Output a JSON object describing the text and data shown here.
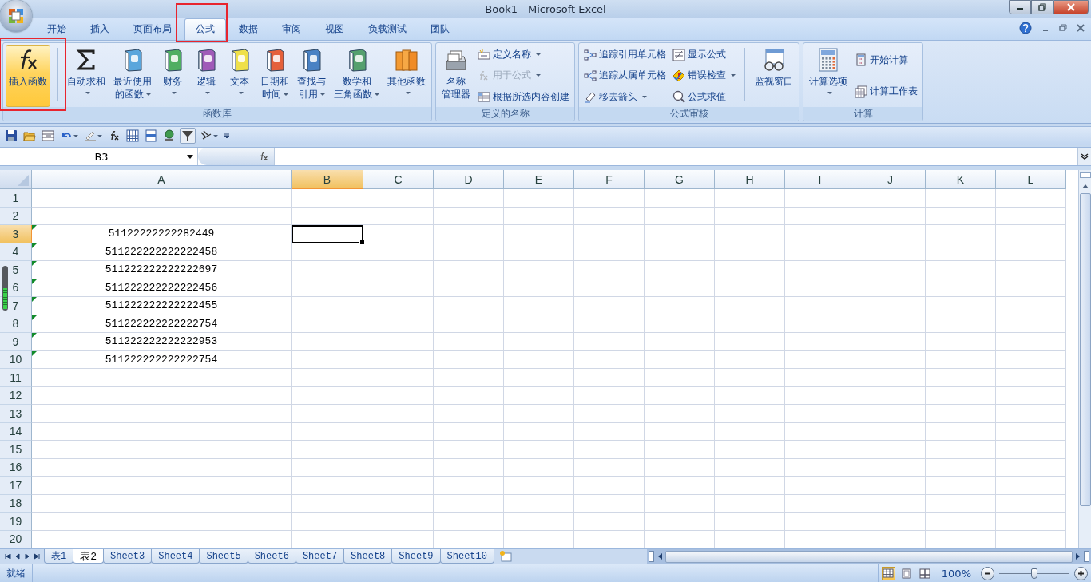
{
  "window": {
    "title": "Book1 - Microsoft Excel"
  },
  "ribbon_tabs": [
    {
      "label": "开始",
      "selected": false,
      "highlighted": false
    },
    {
      "label": "插入",
      "selected": false,
      "highlighted": false
    },
    {
      "label": "页面布局",
      "selected": false,
      "highlighted": false
    },
    {
      "label": "公式",
      "selected": true,
      "highlighted": true
    },
    {
      "label": "数据",
      "selected": false,
      "highlighted": false
    },
    {
      "label": "审阅",
      "selected": false,
      "highlighted": false
    },
    {
      "label": "视图",
      "selected": false,
      "highlighted": false
    },
    {
      "label": "负载测试",
      "selected": false,
      "highlighted": false
    },
    {
      "label": "团队",
      "selected": false,
      "highlighted": false
    }
  ],
  "ribbon_groups": [
    {
      "title": "函数库",
      "controls": [
        {
          "kind": "large",
          "lines": [
            "插入函数"
          ],
          "dropdown": false,
          "highlighted": true
        },
        {
          "kind": "separator"
        },
        {
          "kind": "large",
          "lines": [
            "自动求和"
          ],
          "dropdown": true,
          "highlighted": false
        },
        {
          "kind": "large",
          "lines": [
            "最近使用",
            "的函数"
          ],
          "dropdown": true,
          "highlighted": false
        },
        {
          "kind": "large",
          "lines": [
            "财务"
          ],
          "dropdown": true,
          "highlighted": false
        },
        {
          "kind": "large",
          "lines": [
            "逻辑"
          ],
          "dropdown": true,
          "highlighted": false
        },
        {
          "kind": "large",
          "lines": [
            "文本"
          ],
          "dropdown": true,
          "highlighted": false
        },
        {
          "kind": "large",
          "lines": [
            "日期和",
            "时间"
          ],
          "dropdown": true,
          "highlighted": false
        },
        {
          "kind": "large",
          "lines": [
            "查找与",
            "引用"
          ],
          "dropdown": true,
          "highlighted": false
        },
        {
          "kind": "large",
          "lines": [
            "数学和",
            "三角函数"
          ],
          "dropdown": true,
          "highlighted": false
        },
        {
          "kind": "large",
          "lines": [
            "其他函数"
          ],
          "dropdown": true,
          "highlighted": false
        }
      ]
    },
    {
      "title": "定义的名称",
      "controls": [
        {
          "kind": "large",
          "lines": [
            "名称",
            "管理器"
          ],
          "dropdown": false,
          "highlighted": false
        },
        {
          "kind": "stack",
          "items": [
            {
              "label": "定义名称",
              "dropdown": true,
              "disabled": false
            },
            {
              "label": "用于公式",
              "dropdown": true,
              "disabled": true
            },
            {
              "label": "根据所选内容创建",
              "dropdown": false,
              "disabled": false
            }
          ]
        }
      ]
    },
    {
      "title": "公式审核",
      "controls": [
        {
          "kind": "stack",
          "items": [
            {
              "label": "追踪引用单元格",
              "dropdown": false,
              "disabled": false
            },
            {
              "label": "追踪从属单元格",
              "dropdown": false,
              "disabled": false
            },
            {
              "label": "移去箭头",
              "dropdown": true,
              "disabled": false
            }
          ]
        },
        {
          "kind": "stack",
          "items": [
            {
              "label": "显示公式",
              "dropdown": false,
              "disabled": false
            },
            {
              "label": "错误检查",
              "dropdown": true,
              "disabled": false
            },
            {
              "label": "公式求值",
              "dropdown": false,
              "disabled": false
            }
          ]
        },
        {
          "kind": "separator"
        },
        {
          "kind": "large",
          "lines": [
            "监视窗口"
          ],
          "dropdown": false,
          "highlighted": false
        }
      ]
    },
    {
      "title": "计算",
      "controls": [
        {
          "kind": "large",
          "lines": [
            "计算选项"
          ],
          "dropdown": true,
          "highlighted": false
        },
        {
          "kind": "stack",
          "items": [
            {
              "label": "开始计算",
              "dropdown": false,
              "disabled": false
            },
            {
              "label": "计算工作表",
              "dropdown": false,
              "disabled": false
            }
          ]
        }
      ]
    }
  ],
  "name_box": {
    "value": "B3"
  },
  "sheet": {
    "columns": [
      {
        "label": "A",
        "selected": false
      },
      {
        "label": "B",
        "selected": true
      },
      {
        "label": "C",
        "selected": false
      },
      {
        "label": "D",
        "selected": false
      },
      {
        "label": "E",
        "selected": false
      },
      {
        "label": "F",
        "selected": false
      },
      {
        "label": "G",
        "selected": false
      },
      {
        "label": "H",
        "selected": false
      },
      {
        "label": "I",
        "selected": false
      },
      {
        "label": "J",
        "selected": false
      },
      {
        "label": "K",
        "selected": false
      },
      {
        "label": "L",
        "selected": false
      }
    ],
    "rows": [
      {
        "label": "1",
        "selected": false
      },
      {
        "label": "2",
        "selected": false
      },
      {
        "label": "3",
        "selected": true,
        "cells": [
          {
            "text": "51122222222282449",
            "warning": true,
            "selected": false
          },
          {
            "warning": false,
            "selected": true
          }
        ]
      },
      {
        "label": "4",
        "selected": false,
        "cells": [
          {
            "text": "511222222222222458",
            "warning": true,
            "selected": false
          }
        ]
      },
      {
        "label": "5",
        "selected": false,
        "cells": [
          {
            "text": "511222222222222697",
            "warning": true,
            "selected": false
          }
        ]
      },
      {
        "label": "6",
        "selected": false,
        "cells": [
          {
            "text": "511222222222222456",
            "warning": true,
            "selected": false
          }
        ]
      },
      {
        "label": "7",
        "selected": false,
        "cells": [
          {
            "text": "511222222222222455",
            "warning": true,
            "selected": false
          }
        ]
      },
      {
        "label": "8",
        "selected": false,
        "cells": [
          {
            "text": "511222222222222754",
            "warning": true,
            "selected": false
          }
        ]
      },
      {
        "label": "9",
        "selected": false,
        "cells": [
          {
            "text": "511222222222222953",
            "warning": true,
            "selected": false
          }
        ]
      },
      {
        "label": "10",
        "selected": false,
        "cells": [
          {
            "text": "511222222222222754",
            "warning": true,
            "selected": false
          }
        ]
      },
      {
        "label": "11",
        "selected": false
      },
      {
        "label": "12",
        "selected": false
      },
      {
        "label": "13",
        "selected": false
      },
      {
        "label": "14",
        "selected": false
      },
      {
        "label": "15",
        "selected": false
      },
      {
        "label": "16",
        "selected": false
      },
      {
        "label": "17",
        "selected": false
      },
      {
        "label": "18",
        "selected": false
      },
      {
        "label": "19",
        "selected": false
      },
      {
        "label": "20",
        "selected": false
      }
    ]
  },
  "sheet_tabs": [
    {
      "label": "表1",
      "selected": false
    },
    {
      "label": "表2",
      "selected": true
    },
    {
      "label": "Sheet3",
      "selected": false
    },
    {
      "label": "Sheet4",
      "selected": false
    },
    {
      "label": "Sheet5",
      "selected": false
    },
    {
      "label": "Sheet6",
      "selected": false
    },
    {
      "label": "Sheet7",
      "selected": false
    },
    {
      "label": "Sheet8",
      "selected": false
    },
    {
      "label": "Sheet9",
      "selected": false
    },
    {
      "label": "Sheet10",
      "selected": false
    }
  ],
  "status_bar": {
    "status": "就绪",
    "views": [
      {
        "kind": "normal",
        "selected": true
      },
      {
        "kind": "page_layout",
        "selected": false
      },
      {
        "kind": "page_break",
        "selected": false
      }
    ],
    "zoom": "100%",
    "zoom_slider": {
      "level": 0.5
    }
  }
}
